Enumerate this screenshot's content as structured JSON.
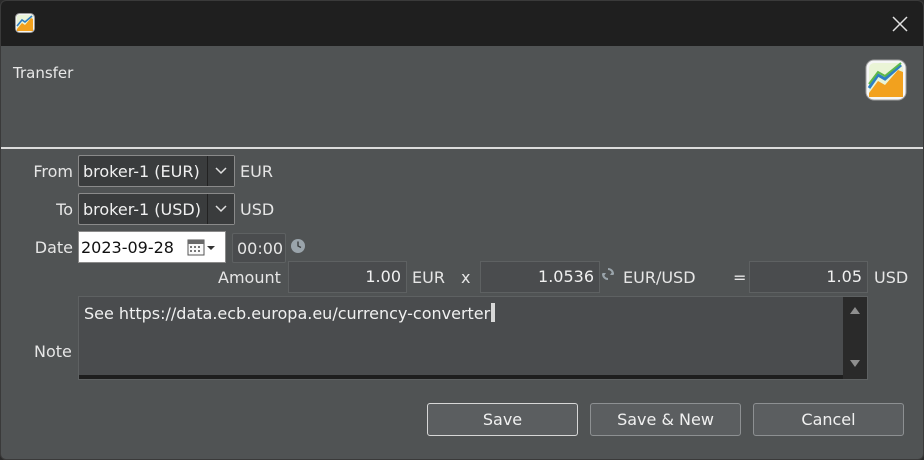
{
  "header": {
    "title": "Transfer"
  },
  "from": {
    "label": "From",
    "account": "broker-1 (EUR)",
    "currency": "EUR"
  },
  "to": {
    "label": "To",
    "account": "broker-1 (USD)",
    "currency": "USD"
  },
  "date": {
    "label": "Date",
    "value": "2023-09-28",
    "time": "00:00"
  },
  "amount": {
    "label": "Amount",
    "value": "1.00",
    "currency": "EUR",
    "times": "x",
    "rate": "1.0536",
    "rate_unit": "EUR/USD",
    "equals": "=",
    "result": "1.05",
    "result_currency": "USD"
  },
  "note": {
    "label": "Note",
    "value": "See https://data.ecb.europa.eu/currency-converter"
  },
  "buttons": {
    "save": "Save",
    "save_new": "Save & New",
    "cancel": "Cancel"
  },
  "icons": {
    "app": "chart-trend-icon",
    "close": "close-icon",
    "dropdown": "chevron-down-icon",
    "calendar": "calendar-icon",
    "clock": "clock-icon",
    "rate": "refresh-rate-icon"
  },
  "colors": {
    "background": "#505354",
    "titlebar": "#1f1f1f",
    "input": "#4a4c4e"
  }
}
